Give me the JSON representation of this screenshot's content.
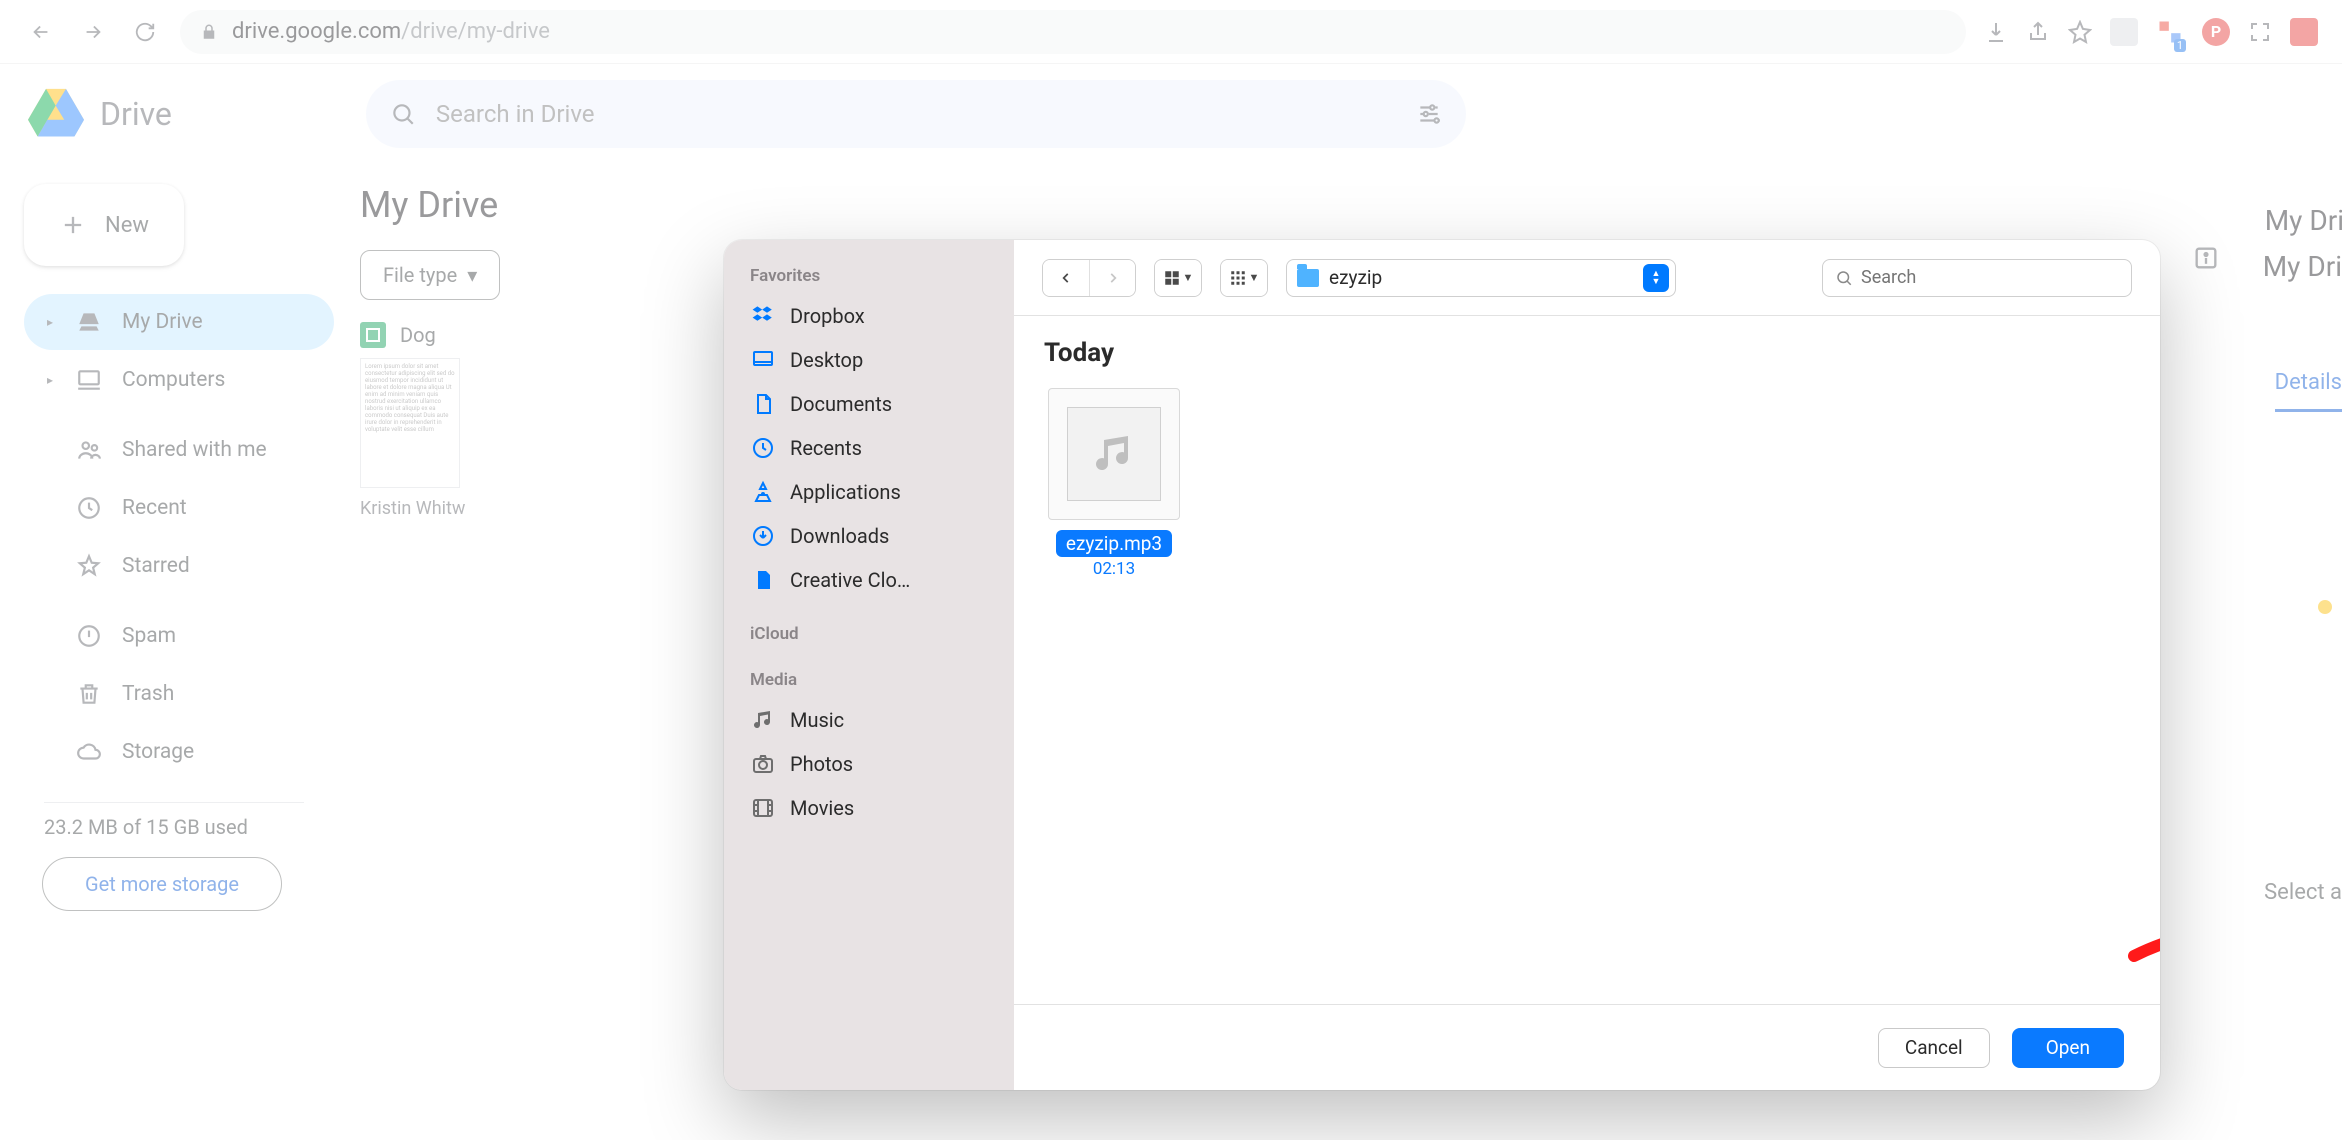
{
  "browser": {
    "url_host": "drive.google.com",
    "url_path": "/drive/my-drive"
  },
  "drive": {
    "product": "Drive",
    "search_placeholder": "Search in Drive",
    "new_button": "New",
    "nav": {
      "my_drive": "My Drive",
      "computers": "Computers",
      "shared": "Shared with me",
      "recent": "Recent",
      "starred": "Starred",
      "spam": "Spam",
      "trash": "Trash",
      "storage": "Storage"
    },
    "storage_used": "23.2 MB of 15 GB used",
    "get_more": "Get more storage",
    "page_title": "My Drive",
    "chip_file_type": "File type",
    "suggested": {
      "file_name_partial": "Dog",
      "file_meta": "Kristin Whitw"
    },
    "right": {
      "title_cut": "My Dri",
      "details_tab": "Details",
      "select_cut": "Select a"
    }
  },
  "dialog": {
    "sidebar": {
      "favorites_label": "Favorites",
      "dropbox": "Dropbox",
      "desktop": "Desktop",
      "documents": "Documents",
      "recents": "Recents",
      "applications": "Applications",
      "downloads": "Downloads",
      "creative": "Creative Clo…",
      "icloud_label": "iCloud",
      "media_label": "Media",
      "music": "Music",
      "photos": "Photos",
      "movies": "Movies"
    },
    "toolbar": {
      "folder_name": "ezyzip",
      "search_placeholder": "Search"
    },
    "body": {
      "group_today": "Today",
      "file_name": "ezyzip.mp3",
      "file_duration": "02:13"
    },
    "footer": {
      "cancel": "Cancel",
      "open": "Open"
    }
  }
}
